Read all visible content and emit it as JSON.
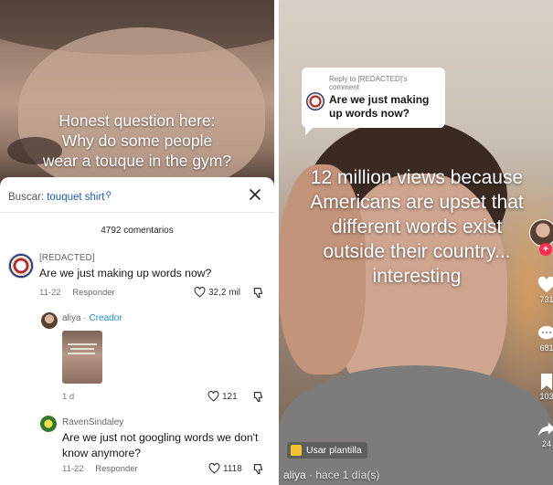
{
  "left": {
    "caption_lines": [
      "Honest question here:",
      "Why do some people",
      "wear a touque in the gym?"
    ],
    "sheet": {
      "search_label": "Buscar:",
      "search_term": "touquet shirt",
      "close_icon": "close-icon",
      "comment_count": "4792 comentarios"
    },
    "comments": [
      {
        "username": "[REDACTED]",
        "text": "Are we just making up words now?",
        "date": "11-22",
        "reply": "Responder",
        "likes": "32,2 mil"
      },
      {
        "username": "aliya",
        "separator": " · ",
        "creator_tag": "Creador",
        "date": "1 d",
        "likes": "121"
      },
      {
        "username": "RavenSindaley",
        "text": "Are we just not googling words we don't know anymore?",
        "date": "11-22",
        "reply": "Responder",
        "likes": "1118"
      }
    ]
  },
  "right": {
    "reply_bubble": {
      "reply_to": "Reply to [REDACTED]'s comment",
      "text": "Are we just making up words now?"
    },
    "caption_lines": [
      "12 million views because",
      "Americans are upset that",
      "different words exist",
      "outside their country...",
      "interesting"
    ],
    "side": {
      "follow": "+",
      "like_count": "731",
      "comment_count": "681",
      "save_count": "103",
      "share_count": "24"
    },
    "template_label": "Usar plantilla",
    "author": "aliya",
    "time_ago": " · hace 1 día(s)"
  },
  "colors": {
    "accent_link": "#1f5da8",
    "creator": "#2b8bbd",
    "follow_red": "#fe2c55"
  }
}
